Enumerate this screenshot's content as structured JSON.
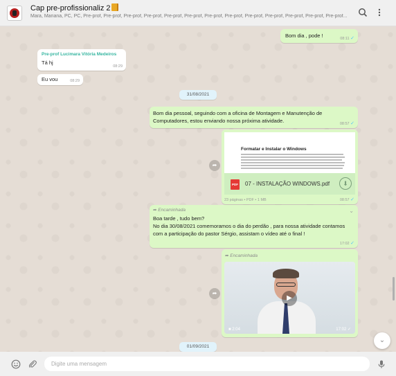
{
  "header": {
    "title": "Cap pre-profissionaliz 2",
    "subtitle": "Mara, Mariana, PC, PC, Pre-prof, Pre-prof, Pre-prof, Pre-prof, Pre-prof, Pre-prof, Pre-prof, Pre-prof, Pre-prof, Pre-prof, Pre-prof, Pre-prof, Pre-prof...",
    "search_icon": "search-icon",
    "menu_icon": "menu-icon"
  },
  "messages": {
    "m1": {
      "text": "Bom dia , pode !",
      "time": "08:11",
      "status": "read"
    },
    "m2": {
      "sender": "Pre-prof Lucimara Vitória Medeiros",
      "text": "Tá hj",
      "time": "08:29"
    },
    "m3": {
      "text": "Eu vou",
      "time": "08:29"
    },
    "date1": "31/08/2021",
    "m4": {
      "text": "Bom dia pessoal, seguindo com a oficina de Montagem e Manutenção de Computadores, estou enviando nossa próxima atividade.",
      "time": "08:57"
    },
    "m5": {
      "preview_title": "Formatar e Instalar o Windows",
      "preview_text": "Em aulas anteriores, como o Windows 10 é fundamental para formatar o Windows você precisará obrigatoriamente possuir um CD/DVD de instalação ou um PenDrive. Com ele pode instalar o Windows em seguida todas as suas informações do Computador. A partir do Windows 10 ele é mais simples.",
      "filename": "07 - INSTALAÇÃO WINDOWS.pdf",
      "info": "23 páginas • PDF • 1 MB",
      "time": "08:57"
    },
    "m6": {
      "forwarded": "Encaminhada",
      "line1": "Boa tarde , tudo bem?",
      "line2": "No dia 30/08/2021 comemoramos o dia do perdão , para nossa atividade contamos com a participação do pastor Sérgio, assistam o vídeo até o final !",
      "time": "17:02"
    },
    "m7": {
      "forwarded": "Encaminhada",
      "duration": "2:04",
      "time": "17:02"
    },
    "date2": "01/09/2021"
  },
  "composer": {
    "placeholder": "Digite uma mensagem"
  },
  "colors": {
    "outgoing": "#dcf8c6",
    "incoming": "#ffffff",
    "wallpaper": "#e5ddd5",
    "sender_name": "#35b5a0",
    "read_tick": "#4fc3f7"
  }
}
